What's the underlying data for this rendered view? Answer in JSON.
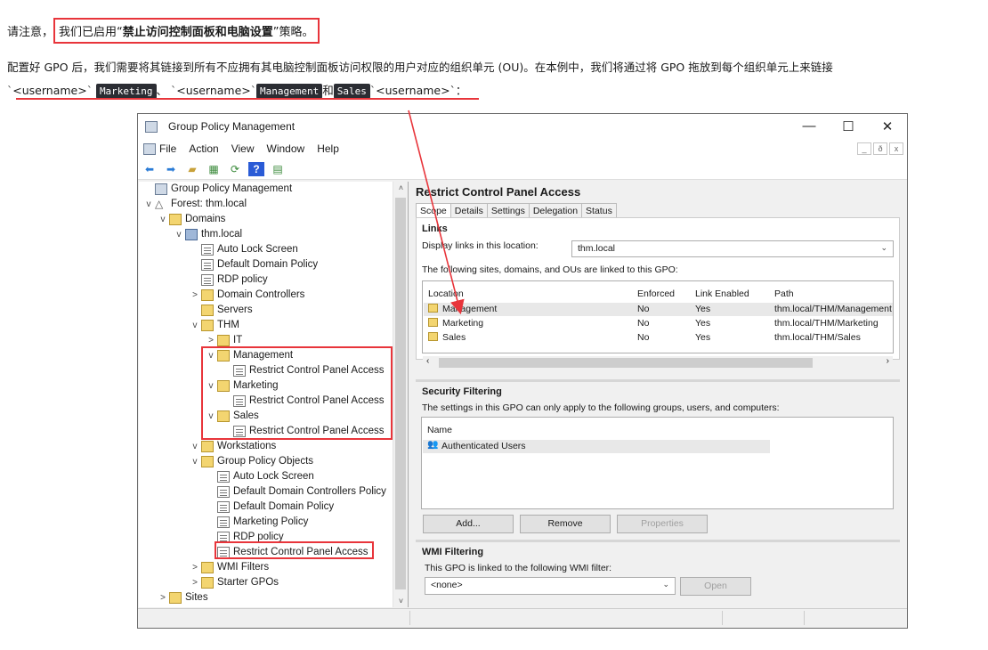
{
  "article": {
    "note_prefix": "请注意，",
    "note_boxed_start": "我们已启用“",
    "note_bold": "禁止访问控制面板和电脑设置",
    "note_boxed_end": "”策略。",
    "para_text": "配置好 GPO 后，我们需要将其链接到所有不应拥有其电脑控制面板访问权限的用户对应的组织单元 (OU)。在本例中，我们将通过将 GPO 拖放到每个组织单元上来链接",
    "tick": "`",
    "username": "<username>",
    "code1": "Marketing",
    "sep1": "、",
    "code2": "Management",
    "sep2": "和",
    "code3": "Sales",
    "end": "`："
  },
  "window": {
    "title": "Group Policy Management",
    "controls": [
      "—",
      "☐",
      "✕"
    ],
    "menu": [
      "File",
      "Action",
      "View",
      "Window",
      "Help"
    ],
    "mdi": [
      "_",
      "ð",
      "x"
    ]
  },
  "tree": [
    {
      "label": "Group Policy Management",
      "icon": "root",
      "exp": ""
    },
    {
      "label": "Forest: thm.local",
      "icon": "forest",
      "exp": "v"
    },
    {
      "label": "Domains",
      "icon": "folder",
      "exp": "v"
    },
    {
      "label": "thm.local",
      "icon": "dom",
      "exp": "v"
    },
    {
      "label": "Auto Lock Screen",
      "icon": "gpo",
      "exp": ""
    },
    {
      "label": "Default Domain Policy",
      "icon": "gpo",
      "exp": ""
    },
    {
      "label": "RDP policy",
      "icon": "gpo",
      "exp": ""
    },
    {
      "label": "Domain Controllers",
      "icon": "folder",
      "exp": ">"
    },
    {
      "label": "Servers",
      "icon": "folder",
      "exp": ""
    },
    {
      "label": "THM",
      "icon": "folder",
      "exp": "v"
    },
    {
      "label": "IT",
      "icon": "folder",
      "exp": ">"
    },
    {
      "label": "Management",
      "icon": "folder",
      "exp": "v"
    },
    {
      "label": "Restrict Control Panel Access",
      "icon": "gpo",
      "exp": ""
    },
    {
      "label": "Marketing",
      "icon": "folder",
      "exp": "v"
    },
    {
      "label": "Restrict Control Panel Access",
      "icon": "gpo",
      "exp": ""
    },
    {
      "label": "Sales",
      "icon": "folder",
      "exp": "v"
    },
    {
      "label": "Restrict Control Panel Access",
      "icon": "gpo",
      "exp": ""
    },
    {
      "label": "Workstations",
      "icon": "folder",
      "exp": "v"
    },
    {
      "label": "Group Policy Objects",
      "icon": "folder",
      "exp": "v"
    },
    {
      "label": "Auto Lock Screen",
      "icon": "gpo",
      "exp": ""
    },
    {
      "label": "Default Domain Controllers Policy",
      "icon": "gpo",
      "exp": ""
    },
    {
      "label": "Default Domain Policy",
      "icon": "gpo",
      "exp": ""
    },
    {
      "label": "Marketing Policy",
      "icon": "gpo",
      "exp": ""
    },
    {
      "label": "RDP policy",
      "icon": "gpo",
      "exp": ""
    },
    {
      "label": "Restrict Control Panel Access",
      "icon": "gpo",
      "exp": ""
    },
    {
      "label": "WMI Filters",
      "icon": "folder",
      "exp": ">"
    },
    {
      "label": "Starter GPOs",
      "icon": "folder",
      "exp": ">"
    },
    {
      "label": "Sites",
      "icon": "folder",
      "exp": ">"
    }
  ],
  "detail": {
    "title": "Restrict Control Panel Access",
    "tabs": [
      "Scope",
      "Details",
      "Settings",
      "Delegation",
      "Status"
    ],
    "links_title": "Links",
    "display_links_label": "Display links in this location:",
    "display_links_value": "thm.local",
    "linked_label": "The following sites, domains, and OUs are linked to this GPO:",
    "links_headers": [
      "Location",
      "Enforced",
      "Link Enabled",
      "Path"
    ],
    "links_rows": [
      [
        "Management",
        "No",
        "Yes",
        "thm.local/THM/Management"
      ],
      [
        "Marketing",
        "No",
        "Yes",
        "thm.local/THM/Marketing"
      ],
      [
        "Sales",
        "No",
        "Yes",
        "thm.local/THM/Sales"
      ]
    ],
    "security_title": "Security Filtering",
    "security_label": "The settings in this GPO can only apply to the following groups, users, and computers:",
    "security_header": "Name",
    "security_rows": [
      "Authenticated Users"
    ],
    "buttons": [
      "Add...",
      "Remove",
      "Properties"
    ],
    "wmi_title": "WMI Filtering",
    "wmi_label": "This GPO is linked to the following WMI filter:",
    "wmi_value": "<none>",
    "wmi_button": "Open"
  }
}
